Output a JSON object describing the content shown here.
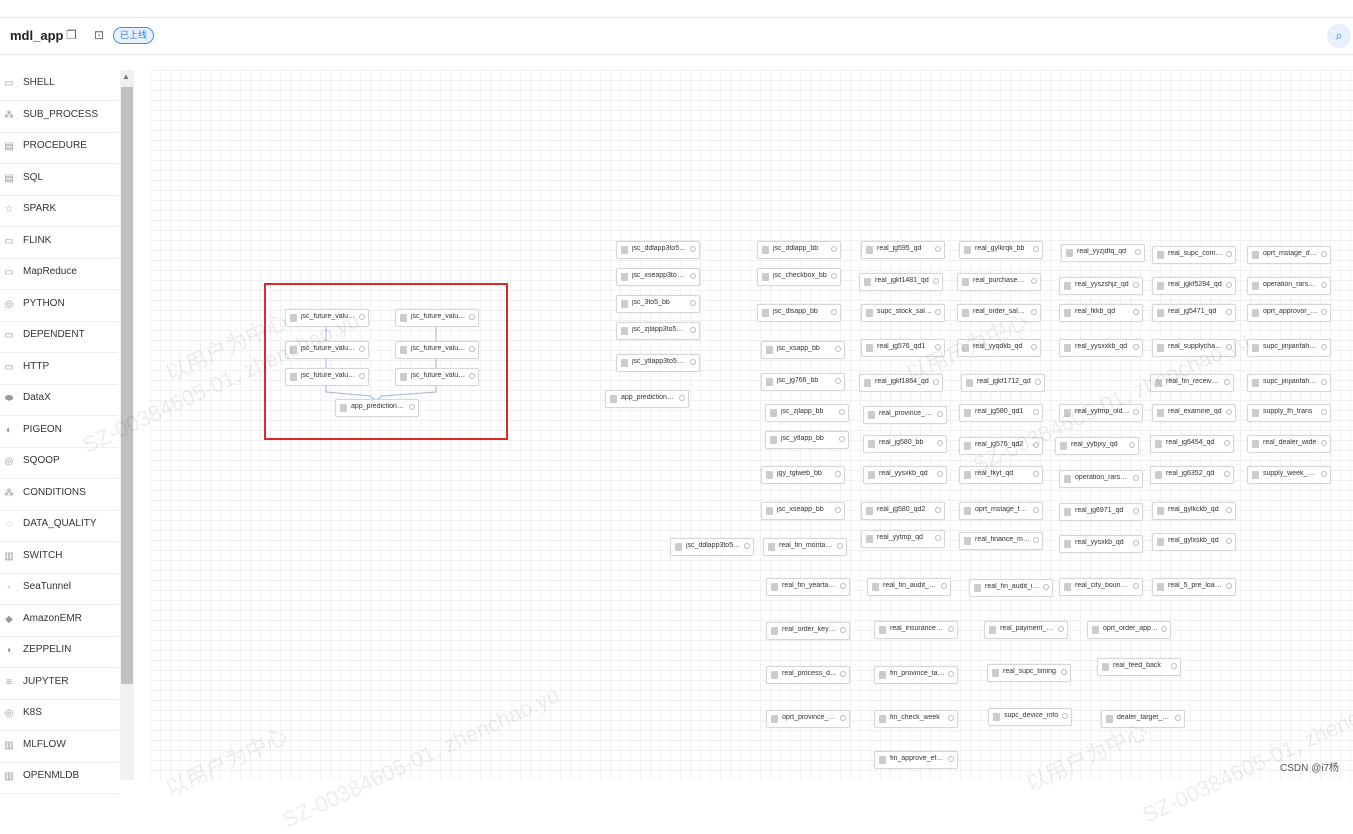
{
  "header": {
    "title": "mdl_app",
    "copy_icon": "copy-icon",
    "online_icon": "online-icon",
    "status_badge": "已上线",
    "search_icon": "search-icon"
  },
  "sidebar": {
    "items": [
      {
        "label": "SHELL",
        "icon": "shell-icon"
      },
      {
        "label": "SUB_PROCESS",
        "icon": "sub-process-icon"
      },
      {
        "label": "PROCEDURE",
        "icon": "procedure-icon"
      },
      {
        "label": "SQL",
        "icon": "sql-icon"
      },
      {
        "label": "SPARK",
        "icon": "spark-icon"
      },
      {
        "label": "FLINK",
        "icon": "flink-icon"
      },
      {
        "label": "MapReduce",
        "icon": "mapreduce-icon"
      },
      {
        "label": "PYTHON",
        "icon": "python-icon"
      },
      {
        "label": "DEPENDENT",
        "icon": "dependent-icon"
      },
      {
        "label": "HTTP",
        "icon": "http-icon"
      },
      {
        "label": "DataX",
        "icon": "datax-icon"
      },
      {
        "label": "PIGEON",
        "icon": "pigeon-icon"
      },
      {
        "label": "SQOOP",
        "icon": "sqoop-icon"
      },
      {
        "label": "CONDITIONS",
        "icon": "conditions-icon"
      },
      {
        "label": "DATA_QUALITY",
        "icon": "data-quality-icon"
      },
      {
        "label": "SWITCH",
        "icon": "switch-icon"
      },
      {
        "label": "SeaTunnel",
        "icon": "seatunnel-icon"
      },
      {
        "label": "AmazonEMR",
        "icon": "amazon-emr-icon"
      },
      {
        "label": "ZEPPELIN",
        "icon": "zeppelin-icon"
      },
      {
        "label": "JUPYTER",
        "icon": "jupyter-icon"
      },
      {
        "label": "K8S",
        "icon": "k8s-icon"
      },
      {
        "label": "MLFLOW",
        "icon": "mlflow-icon"
      },
      {
        "label": "OPENMLDB",
        "icon": "openmldb-icon"
      }
    ]
  },
  "highlight_group": {
    "nodes": [
      "jsc_future_value_p...",
      "jsc_future_value_p...",
      "jsc_future_value_p...",
      "jsc_future_value_p...",
      "jsc_future_value_c...",
      "jsc_future_value_c...",
      "app_prediction_agg"
    ],
    "highlight_color": "#d92b2b"
  },
  "nodes": [
    "jsc_ddlapp3to5_bb",
    "jsc_xseapp3to5_bb",
    "jsc_3to5_bb",
    "jsc_zjlapp3to5_bb",
    "jsc_ytlapp3to5_bb",
    "app_prediction_tim...",
    "jsc_ddlapp_bb",
    "jsc_checkbox_bb",
    "jsc_dlsapp_bb",
    "jsc_xsapp_bb",
    "jsc_jg766_bb",
    "jsc_zjlapp_bb",
    "jsc_ytlapp_bb",
    "jgy_tglweb_bb",
    "jsc_xseapp_bb",
    "jsc_ddlapp3to5_bb_",
    "real_fin_montakein",
    "real_jg595_qd",
    "real_jgkf1481_qd",
    "supc_stock_sale_hi...",
    "real_jg576_qd1",
    "real_jgkf1864_qd",
    "real_province_payb...",
    "real_jg580_bb",
    "real_yysxkb_qd",
    "real_jg580_qd2",
    "real_yytmp_qd",
    "real_gylkrqk_bb",
    "real_purchase_orde...",
    "real_order_sale_st...",
    "real_yyqdkb_qd",
    "real_jgkf1712_qd",
    "real_jg580_qd1",
    "real_jg576_qd2",
    "real_fkyt_qd",
    "oprt_mstage_funnel",
    "real_finance_mon_p...",
    "real_yyzjdtq_qd",
    "real_yyszshjz_qd",
    "real_fkkb_qd",
    "real_yysxxkb_qd",
    "real_yytmp_old_qd",
    "real_yybjxy_qd",
    "operation_rars_pro...",
    "real_jg6971_qd",
    "real_yysxkb_qd",
    "real_supc_compone...",
    "real_jgkf5284_qd",
    "real_jg5471_qd",
    "real_supplychain_p...",
    "real_fin_receivabl...",
    "real_examine_qd",
    "real_jg6454_qd",
    "real_jg6352_qd",
    "real_gylkckb_qd",
    "real_gylxskb_qd",
    "oprt_mstage_durati...",
    "operation_rars_inf...",
    "oprt_approvor_dura...",
    "supc_jinjianfahuo_...",
    "supc_jinjianfahuo_...",
    "supply_fh_trans",
    "real_dealer_wide",
    "supply_week_predit",
    "real_fin_yeartakei...",
    "real_fin_audit_det...",
    "real_fin_audit_int...",
    "real_city_bound_qd",
    "real_5_pre_loan_qd",
    "real_order_keypoin...",
    "real_insurance_man...",
    "real_payment_appli...",
    "oprt_order_approve...",
    "real_process_durat...",
    "fin_province_takei...",
    "real_supc_timing",
    "real_feed_back",
    "oprt_province_day_...",
    "fin_check_week",
    "supc_device_info",
    "dealer_target_valu...",
    "fin_approve_effici..."
  ],
  "watermark": {
    "line1": "以用户为中心",
    "line2": "SZ-00384605-01, zhenchao.yu"
  },
  "footer": {
    "credit": "CSDN @i7杨"
  }
}
